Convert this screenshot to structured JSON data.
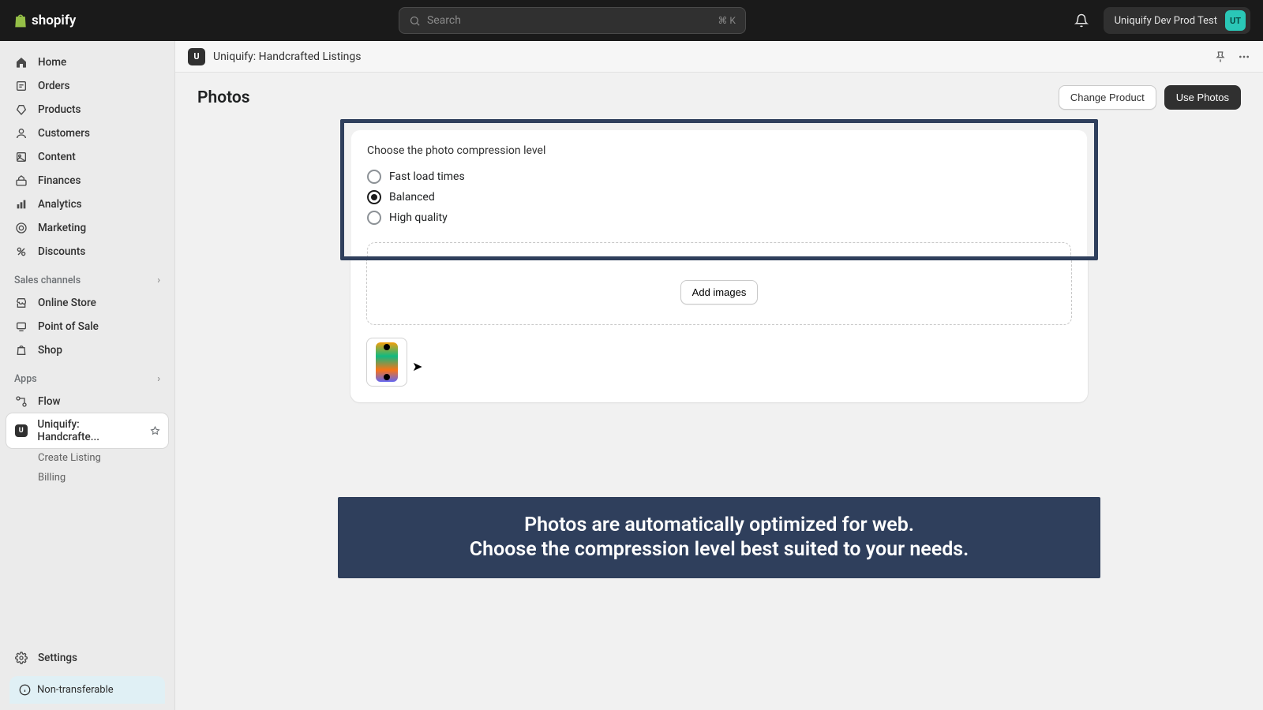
{
  "brand": "shopify",
  "search": {
    "placeholder": "Search",
    "shortcut": "⌘ K"
  },
  "store": {
    "name": "Uniquify Dev Prod Test",
    "initials": "UT"
  },
  "nav": {
    "home": "Home",
    "orders": "Orders",
    "products": "Products",
    "customers": "Customers",
    "content": "Content",
    "finances": "Finances",
    "analytics": "Analytics",
    "marketing": "Marketing",
    "discounts": "Discounts"
  },
  "sections": {
    "sales_channels": "Sales channels",
    "apps": "Apps"
  },
  "channels": {
    "online_store": "Online Store",
    "pos": "Point of Sale",
    "shop": "Shop"
  },
  "apps": {
    "flow": "Flow",
    "uniquify": "Uniquify: Handcrafte...",
    "sub_create": "Create Listing",
    "sub_billing": "Billing"
  },
  "settings": "Settings",
  "badge": "Non-transferable",
  "app_header": {
    "initial": "U",
    "title": "Uniquify: Handcrafted Listings"
  },
  "page": {
    "title": "Photos",
    "change_product": "Change Product",
    "use_photos": "Use Photos"
  },
  "card": {
    "label": "Choose the photo compression level",
    "opt_fast": "Fast load times",
    "opt_balanced": "Balanced",
    "opt_high": "High quality",
    "add_images": "Add images"
  },
  "banner": {
    "line1": "Photos are automatically optimized for web.",
    "line2": "Choose the compression level best suited to your needs."
  }
}
